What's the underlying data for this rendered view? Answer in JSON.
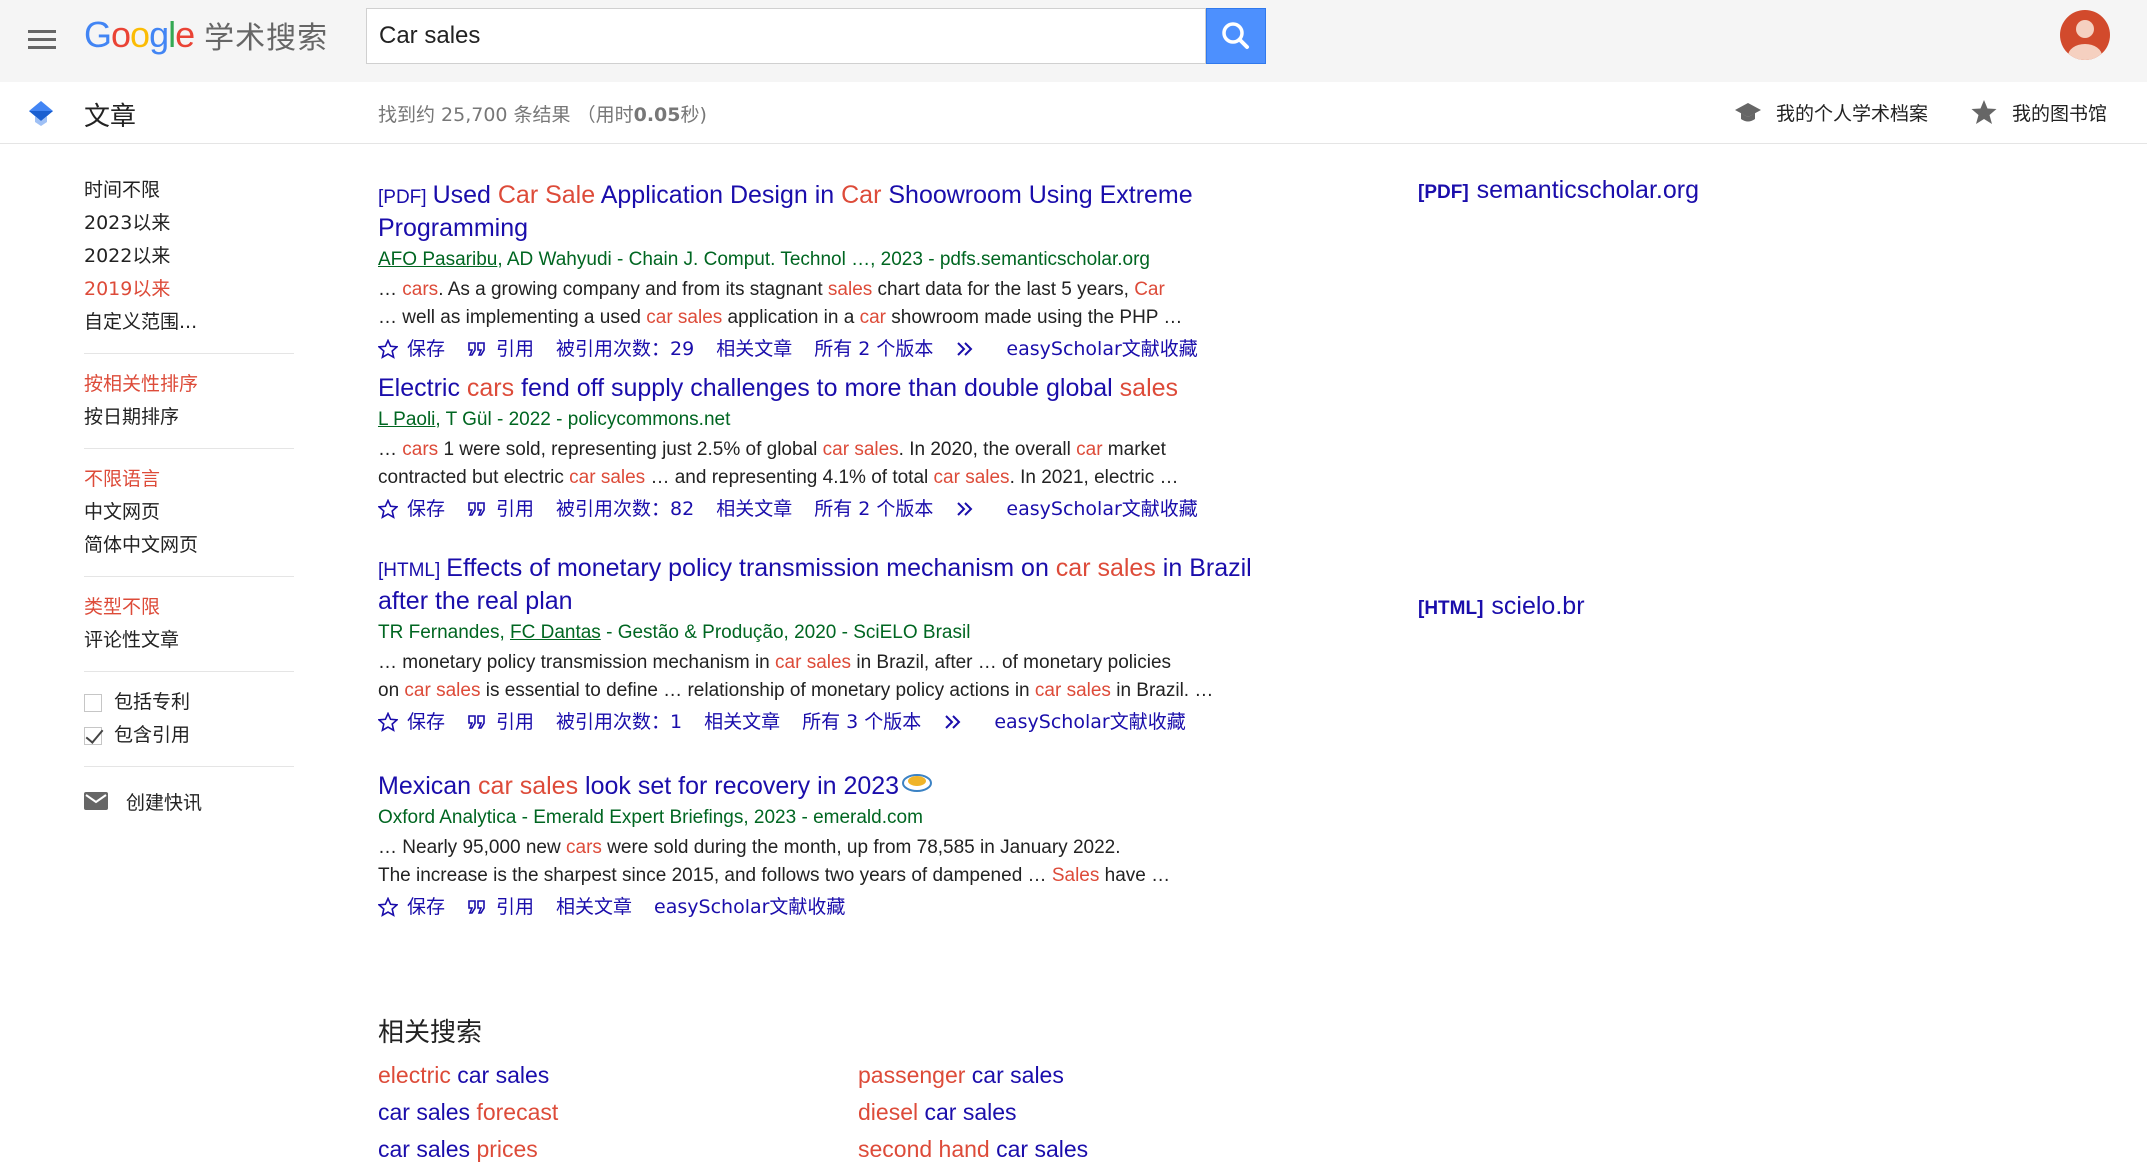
{
  "header": {
    "logo_google": [
      "G",
      "o",
      "o",
      "g",
      "l",
      "e"
    ],
    "logo_colors": [
      "#4285f4",
      "#ea4335",
      "#fbbc05",
      "#4285f4",
      "#34a853",
      "#ea4335"
    ],
    "logo_suffix": "学术搜索",
    "search_value": "Car sales",
    "icons": {
      "menu": "menu-icon",
      "search": "search-icon",
      "avatar": "account-avatar"
    }
  },
  "subheader": {
    "title": "文章",
    "stats_prefix": "找到约 25,700 条结果 （用时",
    "stats_time": "0.05",
    "stats_suffix": "秒)",
    "profile_label": "我的个人学术档案",
    "library_label": "我的图书馆"
  },
  "sidebar": {
    "time_filters": [
      "时间不限",
      "2023以来",
      "2022以来",
      "2019以来",
      "自定义范围..."
    ],
    "time_active": "2019以来",
    "sort_options": [
      "按相关性排序",
      "按日期排序"
    ],
    "sort_active": "按相关性排序",
    "language_options": [
      "不限语言",
      "中文网页",
      "简体中文网页"
    ],
    "language_active": "不限语言",
    "type_options": [
      "类型不限",
      "评论性文章"
    ],
    "type_active": "类型不限",
    "include_patents": "包括专利",
    "include_patents_checked": false,
    "include_citations": "包含引用",
    "include_citations_checked": true,
    "create_alert": "创建快讯"
  },
  "results": [
    {
      "tag": "[PDF]",
      "title_parts": [
        [
          "Used ",
          0
        ],
        [
          "Car Sale",
          1
        ],
        [
          " Application Design in ",
          0
        ],
        [
          "Car",
          1
        ],
        [
          " Shoowroom Using Extreme",
          0
        ]
      ],
      "title_line2": "Programming",
      "authors": [
        [
          "AFO Pasaribu",
          1
        ],
        [
          ", AD Wahyudi",
          0
        ]
      ],
      "meta_rest": " - Chain J. Comput. Technol …, 2023 - pdfs.semanticscholar.org",
      "snippet1": [
        [
          "… ",
          0
        ],
        [
          "cars",
          1
        ],
        [
          ". As a growing company and from its stagnant ",
          0
        ],
        [
          "sales",
          1
        ],
        [
          " chart data for the last 5 years, ",
          0
        ],
        [
          "Car",
          1
        ]
      ],
      "snippet2": [
        [
          "… well as implementing a used ",
          0
        ],
        [
          "car sales",
          1
        ],
        [
          " application in a ",
          0
        ],
        [
          "car",
          1
        ],
        [
          " showroom made using the PHP …",
          0
        ]
      ],
      "actions": {
        "save": "保存",
        "cite": "引用",
        "cited_by": "被引用次数：29",
        "related": "相关文章",
        "versions": "所有 2 个版本",
        "easyscholar": "easyScholar文献收藏"
      },
      "side_tag": "[PDF]",
      "side_domain": "semanticscholar.org"
    },
    {
      "title_parts": [
        [
          "Electric ",
          0
        ],
        [
          "cars",
          1
        ],
        [
          " fend off supply challenges to more than double global ",
          0
        ],
        [
          "sales",
          1
        ]
      ],
      "authors": [
        [
          "L Paoli",
          1
        ],
        [
          ", T Gül",
          0
        ]
      ],
      "meta_rest": " - 2022 - policycommons.net",
      "snippet1": [
        [
          "… ",
          0
        ],
        [
          "cars",
          1
        ],
        [
          " 1 were sold, representing just 2.5% of global ",
          0
        ],
        [
          "car sales",
          1
        ],
        [
          ". In 2020, the overall ",
          0
        ],
        [
          "car",
          1
        ],
        [
          " market",
          0
        ]
      ],
      "snippet2": [
        [
          "contracted but electric ",
          0
        ],
        [
          "car sales",
          1
        ],
        [
          " … and representing 4.1% of total ",
          0
        ],
        [
          "car sales",
          1
        ],
        [
          ". In 2021, electric …",
          0
        ]
      ],
      "actions": {
        "save": "保存",
        "cite": "引用",
        "cited_by": "被引用次数：82",
        "related": "相关文章",
        "versions": "所有 2 个版本",
        "easyscholar": "easyScholar文献收藏"
      }
    },
    {
      "tag": "[HTML]",
      "title_parts": [
        [
          "Effects of monetary policy transmission mechanism on ",
          0
        ],
        [
          "car sales",
          1
        ],
        [
          " in Brazil",
          0
        ]
      ],
      "title_line2": "after the real plan",
      "authors": [
        [
          "TR Fernandes, ",
          0
        ],
        [
          "FC Dantas",
          1
        ]
      ],
      "meta_rest": " - Gestão & Produção, 2020 - SciELO Brasil",
      "snippet1": [
        [
          "… monetary policy transmission mechanism in ",
          0
        ],
        [
          "car sales",
          1
        ],
        [
          " in Brazil, after … of monetary policies",
          0
        ]
      ],
      "snippet2": [
        [
          "on ",
          0
        ],
        [
          "car sales",
          1
        ],
        [
          " is essential to define … relationship of monetary policy actions in ",
          0
        ],
        [
          "car sales",
          1
        ],
        [
          " in Brazil. …",
          0
        ]
      ],
      "actions": {
        "save": "保存",
        "cite": "引用",
        "cited_by": "被引用次数：1",
        "related": "相关文章",
        "versions": "所有 3 个版本",
        "easyscholar": "easyScholar文献收藏"
      },
      "side_tag": "[HTML]",
      "side_domain": "scielo.br"
    },
    {
      "title_parts": [
        [
          "Mexican ",
          0
        ],
        [
          "car sales",
          1
        ],
        [
          " look set for recovery in 2023",
          0
        ]
      ],
      "meta_plain": "Oxford Analytica - Emerald Expert Briefings, 2023 - emerald.com",
      "snippet1": [
        [
          "… Nearly 95,000 new ",
          0
        ],
        [
          "cars",
          1
        ],
        [
          " were sold during the month, up from 78,585 in January 2022.",
          0
        ]
      ],
      "snippet2": [
        [
          "The increase is the sharpest since 2015, and follows two years of dampened … ",
          0
        ],
        [
          "Sales",
          1
        ],
        [
          " have …",
          0
        ]
      ],
      "actions": {
        "save": "保存",
        "cite": "引用",
        "related": "相关文章",
        "easyscholar": "easyScholar文献收藏"
      }
    }
  ],
  "related": {
    "title": "相关搜索",
    "items": [
      [
        [
          "electric",
          1
        ],
        [
          " car sales",
          0
        ]
      ],
      [
        [
          "passenger",
          1
        ],
        [
          " car sales",
          0
        ]
      ],
      [
        [
          "car sales ",
          0
        ],
        [
          "forecast",
          1
        ]
      ],
      [
        [
          "diesel",
          1
        ],
        [
          " car sales",
          0
        ]
      ],
      [
        [
          "car sales ",
          0
        ],
        [
          "prices",
          1
        ]
      ],
      [
        [
          "second hand",
          1
        ],
        [
          " car sales",
          0
        ]
      ]
    ]
  }
}
